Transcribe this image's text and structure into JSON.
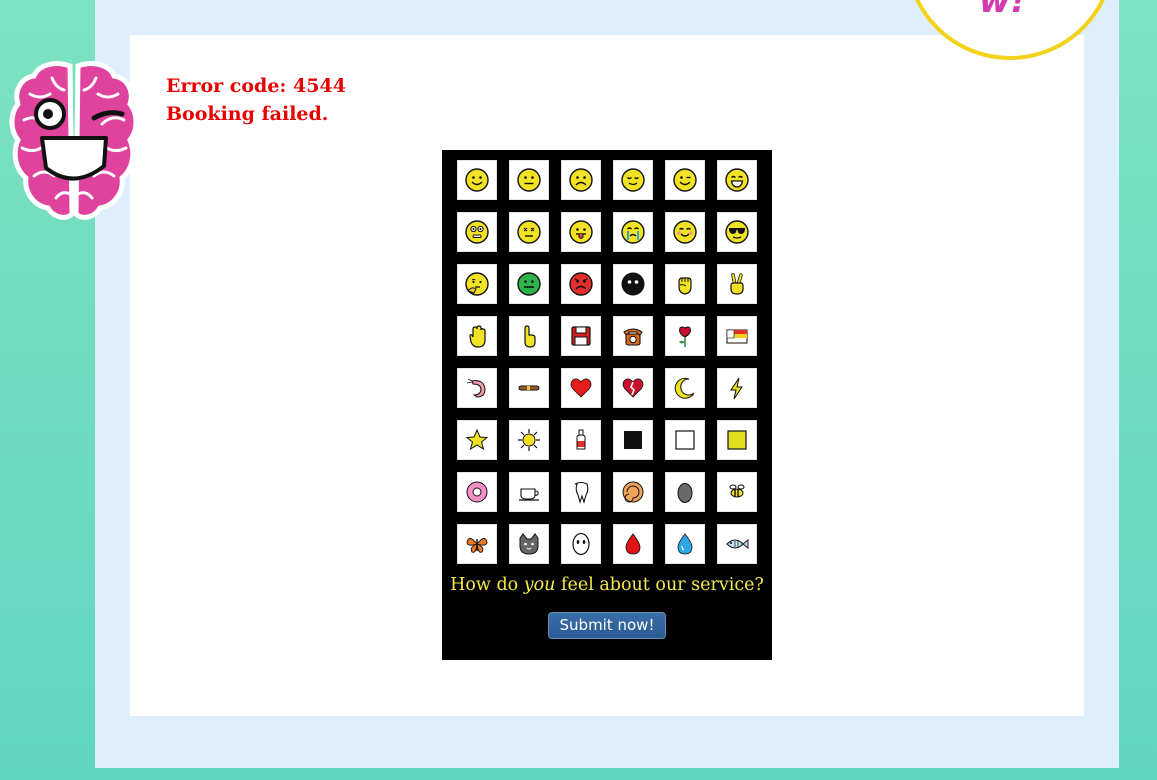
{
  "badge": {
    "text": "w!",
    "border_color": "#f3d21c",
    "text_color": "#d23ab0"
  },
  "mascot": {
    "icon": "winking-brain-icon",
    "color": "#e0439e"
  },
  "error": {
    "code_line": "Error code: 4544",
    "message": "Booking failed.",
    "color": "#e80000"
  },
  "survey": {
    "question_before": "How do ",
    "question_emphasis": "you",
    "question_after": " feel about our service?",
    "question_color": "#f6e94a",
    "submit_label": "Submit now!",
    "options": [
      [
        "smiling-face-icon",
        "neutral-face-icon",
        "frowning-face-icon",
        "relieved-face-icon",
        "winking-face-icon",
        "grinning-face-icon"
      ],
      [
        "flushed-face-icon",
        "dizzy-face-icon",
        "tongue-out-face-icon",
        "crying-face-icon",
        "blushing-face-icon",
        "sunglasses-face-icon"
      ],
      [
        "thinking-face-icon",
        "nauseated-face-icon",
        "angry-face-icon",
        "black-face-icon",
        "raised-fist-icon",
        "victory-hand-icon"
      ],
      [
        "raised-hand-icon",
        "pointing-up-icon",
        "floppy-disk-icon",
        "telephone-icon",
        "rose-icon",
        "flag-icon"
      ],
      [
        "shrimp-icon",
        "cigar-icon",
        "red-heart-icon",
        "broken-heart-icon",
        "crescent-moon-icon",
        "lightning-icon"
      ],
      [
        "star-icon",
        "sun-icon",
        "bottle-icon",
        "black-square-icon",
        "white-square-icon",
        "yellow-square-icon"
      ],
      [
        "donut-icon",
        "coffee-cup-icon",
        "tooth-icon",
        "shell-icon",
        "egg-icon",
        "bee-icon"
      ],
      [
        "butterfly-icon",
        "cat-face-icon",
        "ghost-face-icon",
        "blood-drop-icon",
        "water-drop-icon",
        "fish-icon"
      ]
    ]
  }
}
